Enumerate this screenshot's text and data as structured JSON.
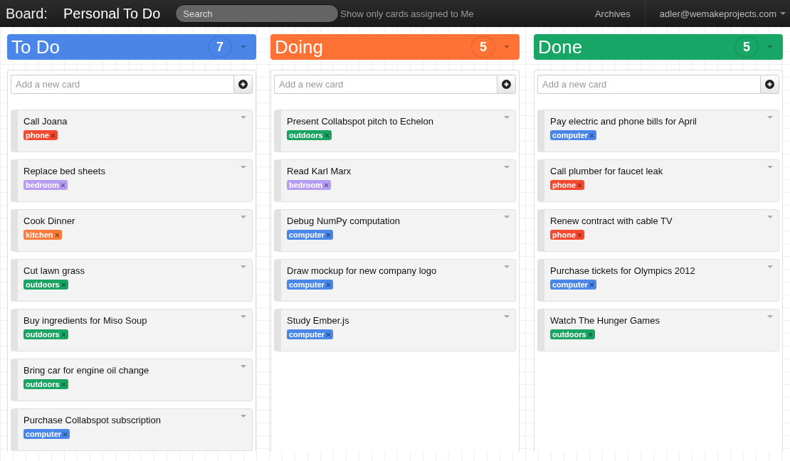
{
  "topbar": {
    "board_label": "Board:",
    "board_name": "Personal To Do",
    "search": {
      "placeholder": "Search"
    },
    "filter_label": "Show only cards assigned to Me",
    "archives": "Archives",
    "user": "adler@wemakeprojects.com"
  },
  "columns": [
    {
      "title": "To Do",
      "count": "7",
      "color": "#4a86e8",
      "add_placeholder": "Add a new card",
      "cards": [
        {
          "title": "Call Joana",
          "tag": {
            "label": "phone",
            "color": "#f4492e"
          }
        },
        {
          "title": "Replace bed sheets",
          "tag": {
            "label": "bedroom",
            "color": "#b79cf5"
          }
        },
        {
          "title": "Cook Dinner",
          "tag": {
            "label": "kitchen",
            "color": "#fa7a3a"
          }
        },
        {
          "title": "Cut lawn grass",
          "tag": {
            "label": "outdoors",
            "color": "#1aa463"
          }
        },
        {
          "title": "Buy ingredients for Miso Soup",
          "tag": {
            "label": "outdoors",
            "color": "#1aa463"
          }
        },
        {
          "title": "Bring car for engine oil change",
          "tag": {
            "label": "outdoors",
            "color": "#1aa463"
          }
        },
        {
          "title": "Purchase Collabspot subscription",
          "tag": {
            "label": "computer",
            "color": "#4a86e8"
          }
        }
      ]
    },
    {
      "title": "Doing",
      "count": "5",
      "color": "#ff7236",
      "add_placeholder": "Add a new card",
      "cards": [
        {
          "title": "Present Collabspot pitch to Echelon",
          "tag": {
            "label": "outdoors",
            "color": "#1aa463"
          }
        },
        {
          "title": "Read Karl Marx",
          "tag": {
            "label": "bedroom",
            "color": "#b79cf5"
          }
        },
        {
          "title": "Debug NumPy computation",
          "tag": {
            "label": "computer",
            "color": "#4a86e8"
          }
        },
        {
          "title": "Draw mockup for new company logo",
          "tag": {
            "label": "computer",
            "color": "#4a86e8"
          }
        },
        {
          "title": "Study Ember.js",
          "tag": {
            "label": "computer",
            "color": "#4a86e8"
          }
        }
      ]
    },
    {
      "title": "Done",
      "count": "5",
      "color": "#17a665",
      "add_placeholder": "Add a new card",
      "cards": [
        {
          "title": "Pay electric and phone bills for April",
          "tag": {
            "label": "computer",
            "color": "#4a86e8"
          }
        },
        {
          "title": "Call plumber for faucet leak",
          "tag": {
            "label": "phone",
            "color": "#f4492e"
          }
        },
        {
          "title": "Renew contract with cable TV",
          "tag": {
            "label": "phone",
            "color": "#f4492e"
          }
        },
        {
          "title": "Purchase tickets for Olympics 2012",
          "tag": {
            "label": "computer",
            "color": "#4a86e8"
          }
        },
        {
          "title": "Watch The Hunger Games",
          "tag": {
            "label": "outdoors",
            "color": "#1aa463"
          }
        }
      ]
    }
  ]
}
